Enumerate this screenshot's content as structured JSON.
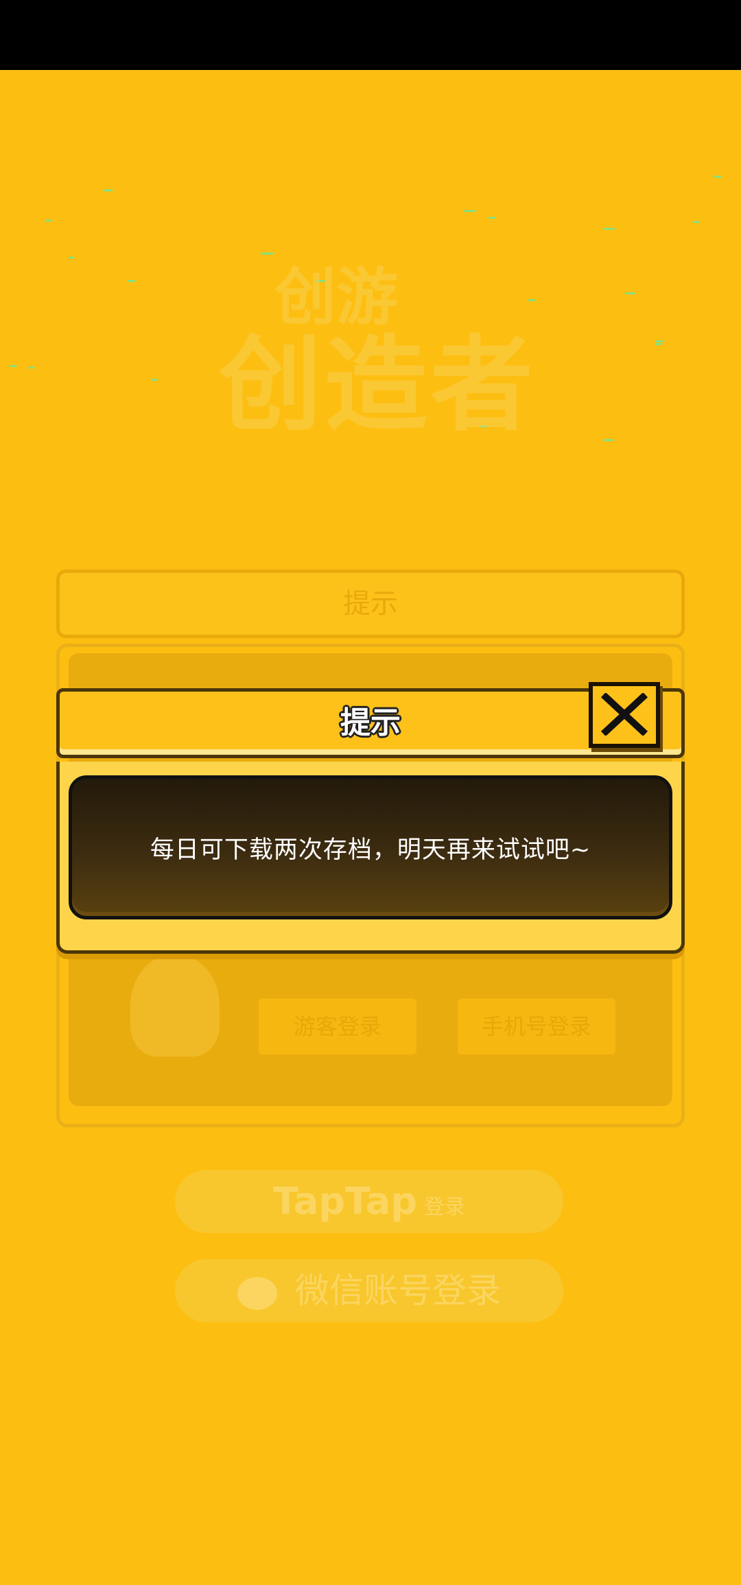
{
  "background": {
    "logo_sub": "创游",
    "logo_title": "创造者",
    "panel_title": "提示",
    "guest_login_label": "游客登录",
    "phone_login_label": "手机号登录",
    "taptap_label": "TapTap",
    "taptap_suffix": "登录",
    "wechat_label": "微信账号登录"
  },
  "dialog": {
    "title": "提示",
    "close_icon": "close-x-icon",
    "message": "每日可下载两次存档，明天再来试试吧~"
  },
  "colors": {
    "background": "#FDBE12",
    "dialog_header": "#FDC11A",
    "message_box_dark": "#2a1f0c",
    "message_text": "#FFFFFF"
  }
}
